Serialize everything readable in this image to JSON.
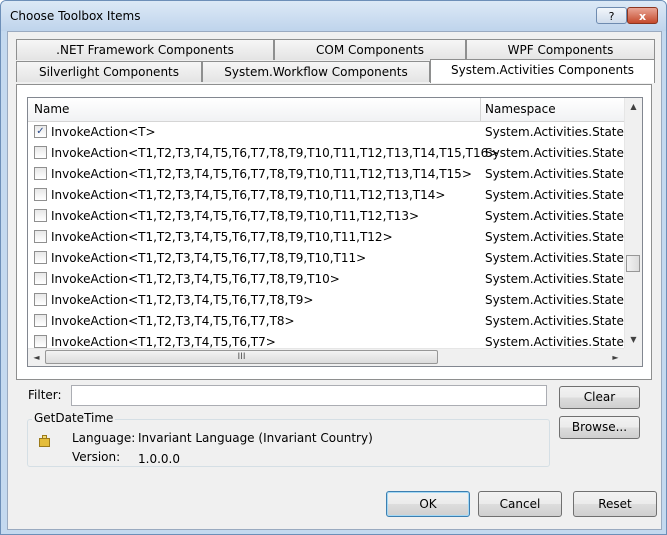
{
  "window": {
    "title": "Choose Toolbox Items",
    "help_label": "?",
    "close_label": "x"
  },
  "tabs": {
    "row1": [
      ".NET Framework Components",
      "COM Components",
      "WPF Components"
    ],
    "row2": [
      "Silverlight Components",
      "System.Workflow Components",
      "System.Activities Components"
    ],
    "active": "System.Activities Components"
  },
  "grid": {
    "columns": [
      "Name",
      "Namespace"
    ],
    "rows": [
      {
        "checked": true,
        "name": "InvokeAction<T>",
        "namespace": "System.Activities.Statements"
      },
      {
        "checked": false,
        "name": "InvokeAction<T1,T2,T3,T4,T5,T6,T7,T8,T9,T10,T11,T12,T13,T14,T15,T16>",
        "namespace": "System.Activities.Statements"
      },
      {
        "checked": false,
        "name": "InvokeAction<T1,T2,T3,T4,T5,T6,T7,T8,T9,T10,T11,T12,T13,T14,T15>",
        "namespace": "System.Activities.Statements"
      },
      {
        "checked": false,
        "name": "InvokeAction<T1,T2,T3,T4,T5,T6,T7,T8,T9,T10,T11,T12,T13,T14>",
        "namespace": "System.Activities.Statements"
      },
      {
        "checked": false,
        "name": "InvokeAction<T1,T2,T3,T4,T5,T6,T7,T8,T9,T10,T11,T12,T13>",
        "namespace": "System.Activities.Statements"
      },
      {
        "checked": false,
        "name": "InvokeAction<T1,T2,T3,T4,T5,T6,T7,T8,T9,T10,T11,T12>",
        "namespace": "System.Activities.Statements"
      },
      {
        "checked": false,
        "name": "InvokeAction<T1,T2,T3,T4,T5,T6,T7,T8,T9,T10,T11>",
        "namespace": "System.Activities.Statements"
      },
      {
        "checked": false,
        "name": "InvokeAction<T1,T2,T3,T4,T5,T6,T7,T8,T9,T10>",
        "namespace": "System.Activities.Statements"
      },
      {
        "checked": false,
        "name": "InvokeAction<T1,T2,T3,T4,T5,T6,T7,T8,T9>",
        "namespace": "System.Activities.Statements"
      },
      {
        "checked": false,
        "name": "InvokeAction<T1,T2,T3,T4,T5,T6,T7,T8>",
        "namespace": "System.Activities.Statements"
      },
      {
        "checked": false,
        "name": "InvokeAction<T1,T2,T3,T4,T5,T6,T7>",
        "namespace": "System.Activities.Statements"
      }
    ],
    "scroll_up": "▲",
    "scroll_down": "▼",
    "scroll_left": "◄",
    "scroll_right": "►",
    "hthumb_grip": "III"
  },
  "filter": {
    "label": "Filter:",
    "value": ""
  },
  "buttons": {
    "clear": "Clear",
    "browse": "Browse...",
    "ok": "OK",
    "cancel": "Cancel",
    "reset": "Reset"
  },
  "details": {
    "group_title": "GetDateTime",
    "icon": "assembly-icon",
    "language_label": "Language:",
    "language_value": "Invariant Language (Invariant Country)",
    "version_label": "Version:",
    "version_value": "1.0.0.0"
  },
  "colors": {
    "title_gradient_top": "#dce9f6",
    "title_gradient_bottom": "#bfd4ec",
    "close_red": "#c54a2c",
    "default_button_border": "#3c7fb1"
  }
}
